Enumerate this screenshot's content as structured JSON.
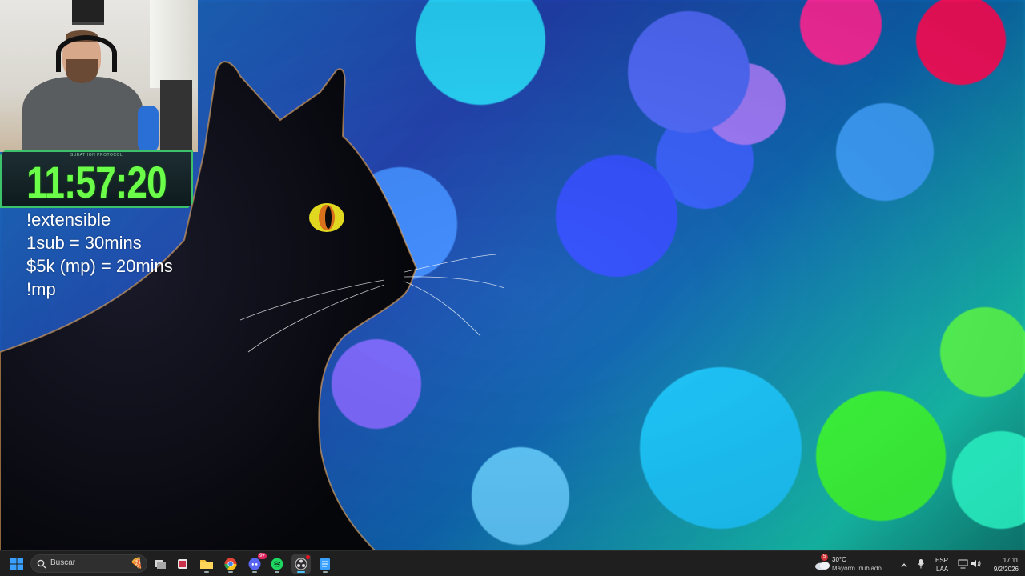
{
  "overlay": {
    "timer_caption": "SUBATHON PROTOCOL",
    "timer_value": "11:57:20",
    "lines": [
      "!extensible",
      "1sub = 30mins",
      "$5k (mp) = 20mins",
      "!mp"
    ]
  },
  "taskbar": {
    "search_label": "Buscar",
    "apps": [
      "windows-start",
      "task-view",
      "snipping",
      "file-explorer",
      "chrome",
      "discord",
      "spotify",
      "obs",
      "notepad"
    ],
    "discord_badge": "9+",
    "weather": {
      "badge": "5",
      "temp": "30°C",
      "condition": "Mayorm. nublado"
    },
    "language": {
      "lang": "ESP",
      "layout": "LAA"
    },
    "clock": {
      "time": "17:11",
      "date": "9/2/2026"
    }
  },
  "colors": {
    "timer_green": "#6bff4a",
    "taskbar_bg": "#1f1f1f",
    "accent_blue": "#0078d4"
  }
}
